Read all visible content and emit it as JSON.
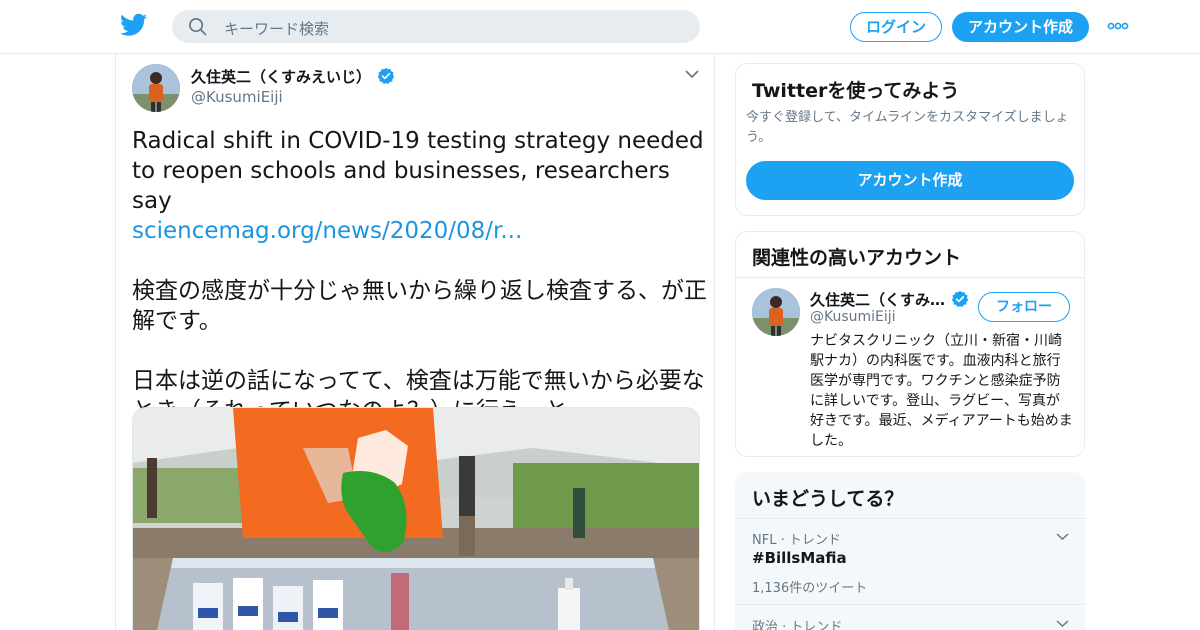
{
  "header": {
    "logo_icon": "twitter-bird-icon",
    "search_placeholder": "キーワード検索",
    "login_label": "ログイン",
    "signup_label": "アカウント作成",
    "more_icon": "more-dots-icon",
    "accent_color": "#1da1f2"
  },
  "tweet": {
    "author_name": "久住英二（くすみえいじ）",
    "author_handle": "@KusumiEiji",
    "verified_icon": "verified-badge-icon",
    "text_en": "Radical shift in COVID-19 testing strategy needed to reopen schools and businesses, researchers say",
    "link_text": "sciencemag.org/news/2020/08/r...",
    "text_jp1": "検査の感度が十分じゃ無いから繰り返し検査する、が正解です。",
    "text_jp2": "日本は逆の話になってて、検査は万能で無いから必要なとき（それっていつなのよ？）に行え、と。",
    "photo_icon": "tweet-photo-testing-tent"
  },
  "signup_card": {
    "title": "Twitterを使ってみよう",
    "subtitle": "今すぐ登録して、タイムラインをカスタマイズしましょう。",
    "button_label": "アカウント作成"
  },
  "related": {
    "title": "関連性の高いアカウント",
    "name": "久住英二（くすみ…",
    "handle": "@KusumiEiji",
    "follow_label": "フォロー",
    "bio": "ナビタスクリニック（立川・新宿・川崎駅ナカ）の内科医です。血液内科と旅行医学が専門です。ワクチンと感染症予防に詳しいです。登山、ラグビー、写真が好きです。最近、メディアアートも始めました。"
  },
  "trends": {
    "title": "いまどうしてる？",
    "items": [
      {
        "meta": "NFL · トレンド",
        "name": "#BillsMafia",
        "count": "1,136件のツイート"
      },
      {
        "meta": "政治 · トレンド"
      }
    ]
  }
}
